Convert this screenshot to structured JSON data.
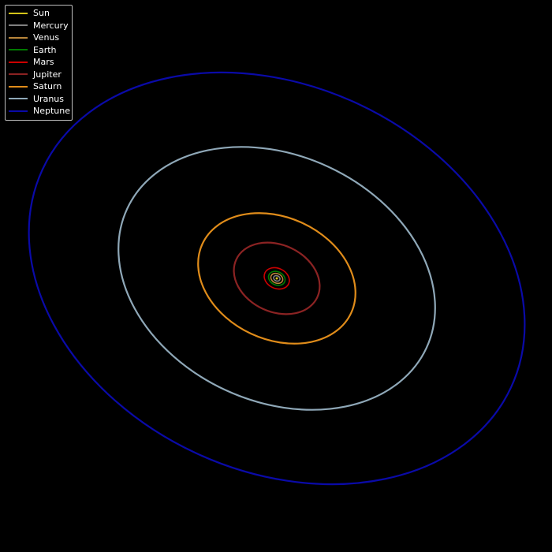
{
  "chart_data": {
    "type": "line",
    "title": "",
    "xlabel": "",
    "ylabel": "",
    "grid": false,
    "axes_visible": false,
    "background": "#000000",
    "legend_location": "top-left",
    "series": [
      {
        "name": "Sun",
        "color": "#d4c41a",
        "orbit": {
          "a": 0.0,
          "b": 0.0,
          "rotation_deg": 0
        }
      },
      {
        "name": "Mercury",
        "color": "#808080",
        "orbit": {
          "a": 0.39,
          "b": 0.3,
          "rotation_deg": 25
        }
      },
      {
        "name": "Venus",
        "color": "#b8863b",
        "orbit": {
          "a": 0.72,
          "b": 0.55,
          "rotation_deg": 25
        }
      },
      {
        "name": "Earth",
        "color": "#007a00",
        "orbit": {
          "a": 1.0,
          "b": 0.77,
          "rotation_deg": 25
        }
      },
      {
        "name": "Mars",
        "color": "#cc0000",
        "orbit": {
          "a": 1.52,
          "b": 1.17,
          "rotation_deg": 25
        }
      },
      {
        "name": "Jupiter",
        "color": "#8b2323",
        "orbit": {
          "a": 5.2,
          "b": 3.9,
          "rotation_deg": 25
        }
      },
      {
        "name": "Saturn",
        "color": "#e08c1a",
        "orbit": {
          "a": 9.54,
          "b": 7.1,
          "rotation_deg": 25
        }
      },
      {
        "name": "Uranus",
        "color": "#8fa8b8",
        "orbit": {
          "a": 19.2,
          "b": 14.3,
          "rotation_deg": 25
        }
      },
      {
        "name": "Neptune",
        "color": "#0a0aa8",
        "orbit": {
          "a": 30.06,
          "b": 22.4,
          "rotation_deg": 25
        }
      }
    ]
  }
}
